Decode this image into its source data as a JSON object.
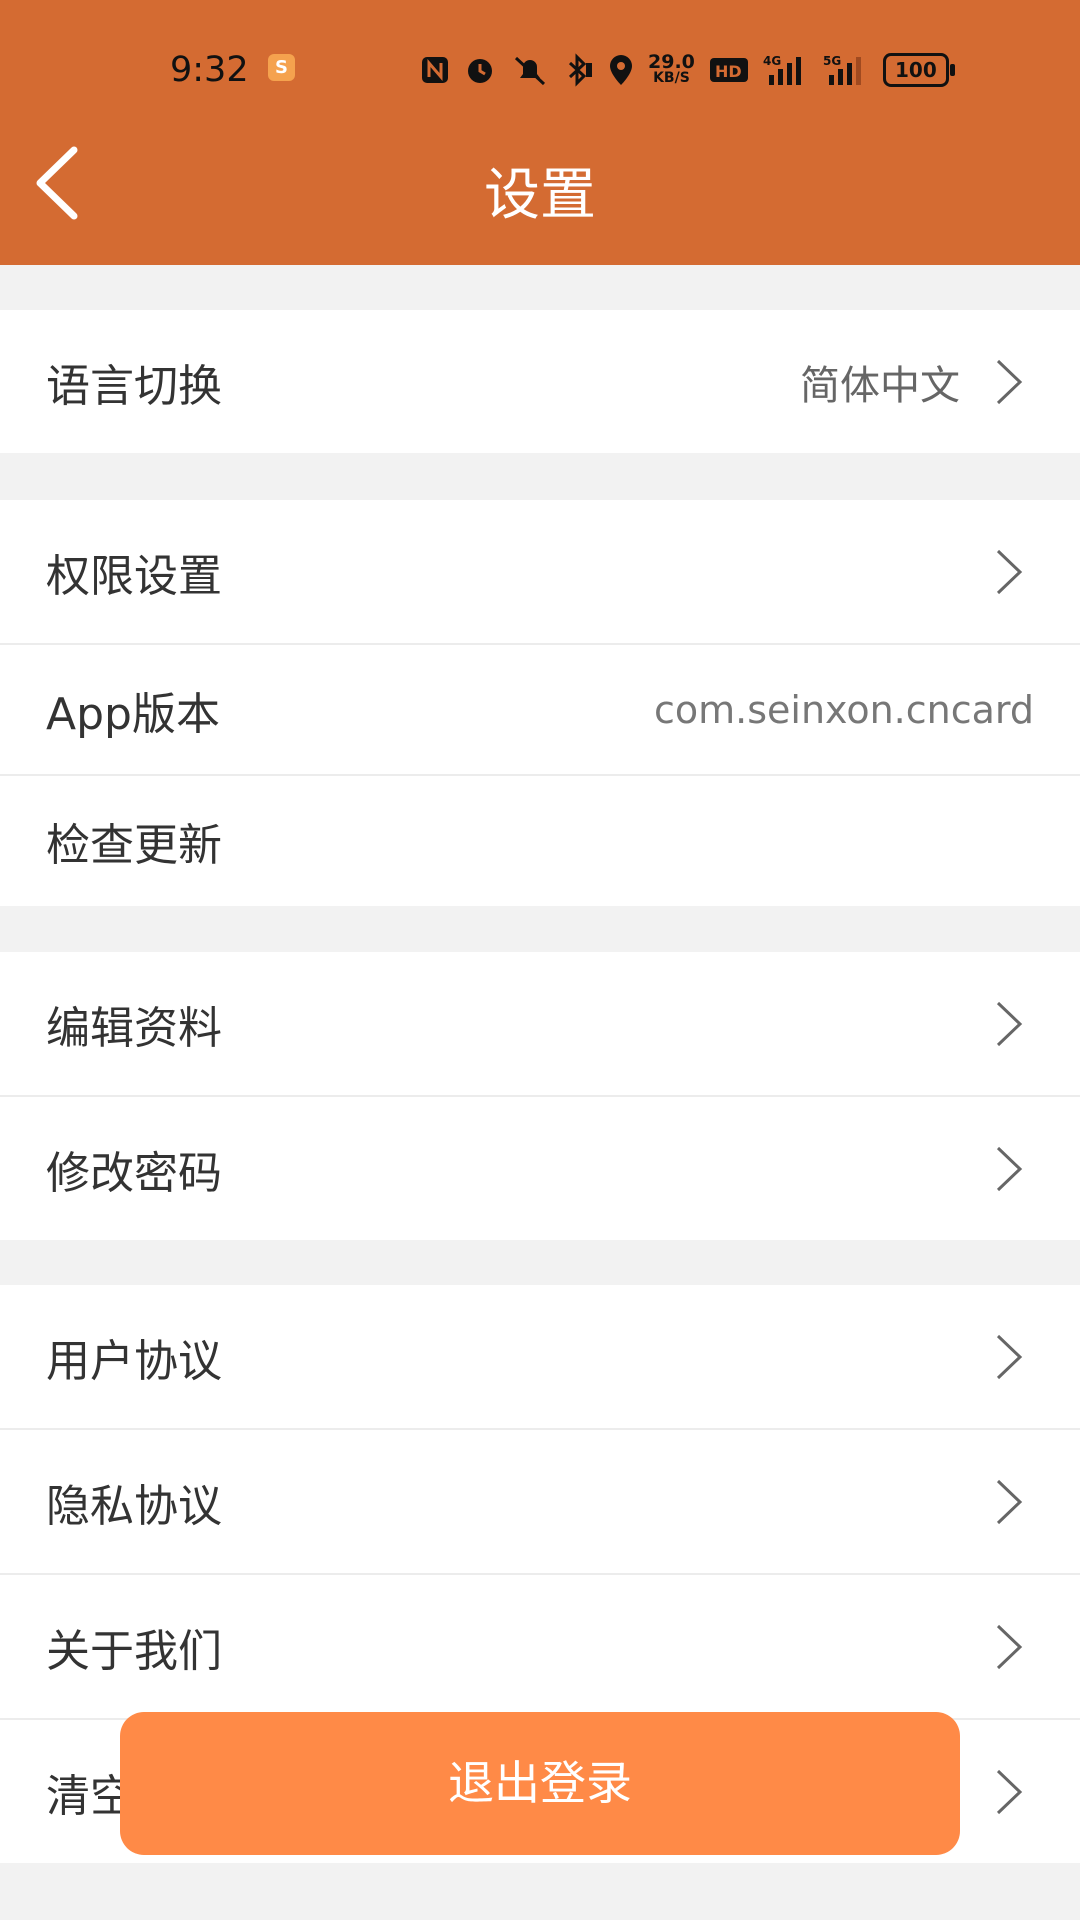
{
  "status_bar": {
    "time": "9:32",
    "app_icon_letter": "S",
    "net_speed_value": "29.0",
    "net_speed_unit": "KB/S",
    "battery": "100",
    "icons": [
      "nfc-icon",
      "alarm-icon",
      "mute-icon",
      "bluetooth-icon",
      "location-icon",
      "hd-icon",
      "signal-4g-icon",
      "signal-5g-icon",
      "battery-icon"
    ]
  },
  "header": {
    "title": "设置",
    "background_color": "#d46b32"
  },
  "groups": [
    {
      "items": [
        {
          "label": "语言切换",
          "value": "简体中文",
          "has_arrow": true
        }
      ]
    },
    {
      "items": [
        {
          "label": "权限设置",
          "value": "",
          "has_arrow": true
        },
        {
          "label": "App版本",
          "value": "com.seinxon.cncard",
          "has_arrow": false
        },
        {
          "label": "检查更新",
          "value": "",
          "has_arrow": false
        }
      ]
    },
    {
      "items": [
        {
          "label": "编辑资料",
          "value": "",
          "has_arrow": true
        },
        {
          "label": "修改密码",
          "value": "",
          "has_arrow": true
        }
      ]
    },
    {
      "items": [
        {
          "label": "用户协议",
          "value": "",
          "has_arrow": true
        },
        {
          "label": "隐私协议",
          "value": "",
          "has_arrow": true
        },
        {
          "label": "关于我们",
          "value": "",
          "has_arrow": true
        },
        {
          "label": "清空",
          "value": "",
          "has_arrow": true
        }
      ]
    }
  ],
  "logout": {
    "label": "退出登录",
    "color": "#ff8a47"
  }
}
